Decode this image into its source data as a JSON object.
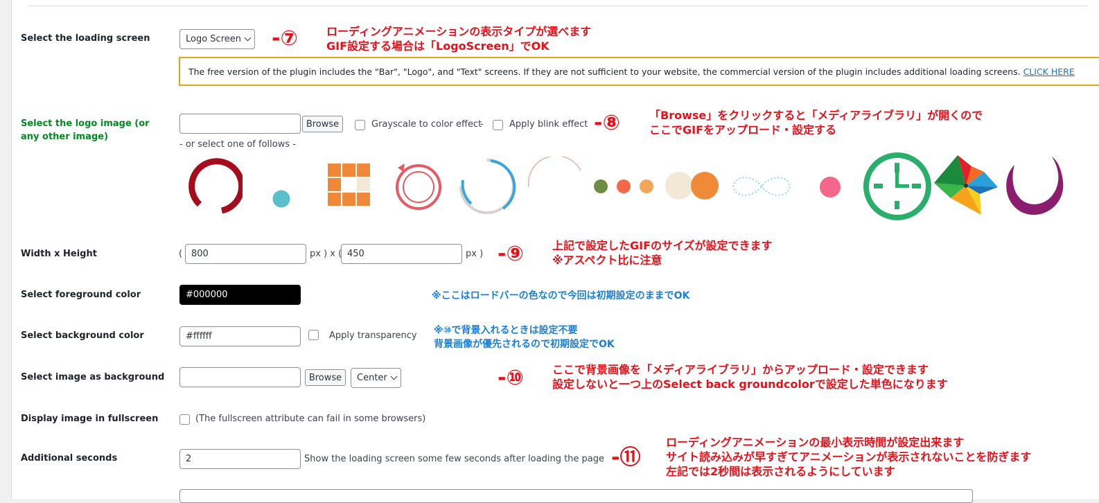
{
  "rows": {
    "loading_screen": {
      "label": "Select the loading screen",
      "select_value": "Logo Screen",
      "notice_text": "The free version of the plugin includes the \"Bar\", \"Logo\", and \"Text\" screens. If they are not sufficient to your website, the commercial version of the plugin includes additional loading screens.",
      "notice_link": "CLICK HERE"
    },
    "logo_image": {
      "label": "Select the logo image (or any other image)",
      "input_value": "",
      "browse_label": "Browse",
      "grayscale_label": "Grayscale to color effect",
      "separator": "-",
      "blink_label": "Apply blink effect",
      "or_select": "- or select one of follows -",
      "loader_icons": [
        "ring-loader-icon",
        "dot-loader-icon",
        "grid-loader-icon",
        "bubble-ring-loader-icon",
        "circle-arc-loader-icon",
        "thin-arc-loader-icon",
        "three-dots-loader-icon",
        "two-circles-loader-icon",
        "infinity-loader-icon",
        "pink-dot-loader-icon",
        "clock-loader-icon",
        "pinwheel-loader-icon",
        "purple-arc-loader-icon"
      ]
    },
    "size": {
      "label": "Width x Height",
      "open_paren": "(",
      "width": "800",
      "px_x": "px ) x (",
      "height": "450",
      "px_close": "px )"
    },
    "foreground": {
      "label": "Select foreground color",
      "value": "#000000"
    },
    "background": {
      "label": "Select background color",
      "value": "#ffffff",
      "transparency_label": "Apply transparency"
    },
    "bg_image": {
      "label": "Select image as background",
      "input_value": "",
      "browse_label": "Browse",
      "position_value": "Center"
    },
    "fullscreen": {
      "label": "Display image in fullscreen",
      "note": "(The fullscreen attribute can fail in some browsers)"
    },
    "seconds": {
      "label": "Additional seconds",
      "value": "2",
      "hint": "Show the loading screen some few seconds after loading the page"
    }
  },
  "annotations": {
    "n7": {
      "num": "-⑦",
      "line1": "ローディングアニメーションの表示タイプが選べます",
      "line2": "GIF設定する場合は「LogoScreen」でOK"
    },
    "n8": {
      "num": "-⑧",
      "line1": "「Browse」をクリックすると「メディアライブラリ」が開くので",
      "line2": "ここでGIFをアップロード・設定する"
    },
    "n9": {
      "num": "-⑨",
      "line1": "上記で設定したGIFのサイズが設定できます",
      "line2": "※アスペクト比に注意"
    },
    "fg_note": "※ここはロードバーの色なので今回は初期設定のままでOK",
    "bg_note": {
      "line1": "※⑩で背景入れるときは設定不要",
      "line2": "背景画像が優先されるので初期設定でOK"
    },
    "n10": {
      "num": "-⑩",
      "line1": "ここで背景画像を「メディアライブラリ」からアップロード・設定できます",
      "line2": "設定しないと一つ上のSelect back groundcolorで設定した単色になります"
    },
    "n11": {
      "num": "-⑪",
      "line1": "ローディングアニメーションの最小表示時間が設定出来ます",
      "line2": "サイト読み込みが早すぎてアニメーションが表示されないことを防ぎます",
      "line3": "左記では2秒間は表示されるようにしています"
    }
  },
  "colors": {
    "label_green": "#008a20",
    "notice_border": "#dba617",
    "annotation_red": "#e8111b",
    "annotation_blue": "#1a7fd9",
    "link_blue": "#2271b1"
  }
}
